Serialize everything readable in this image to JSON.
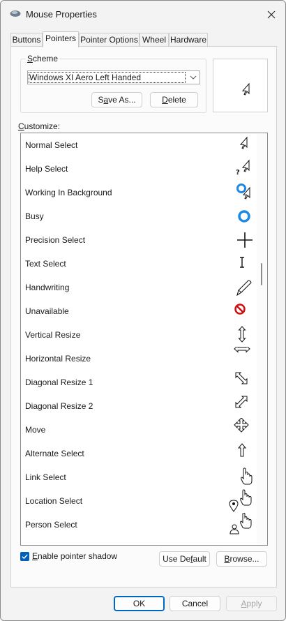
{
  "window": {
    "title": "Mouse Properties",
    "close_label": "×"
  },
  "tabs": [
    {
      "label": "Buttons",
      "active": false
    },
    {
      "label": "Pointers",
      "active": true
    },
    {
      "label": "Pointer Options",
      "active": false
    },
    {
      "label": "Wheel",
      "active": false
    },
    {
      "label": "Hardware",
      "active": false
    }
  ],
  "scheme": {
    "legend": "Scheme",
    "selected": "Windows XI Aero Left Handed",
    "save_as_label": "Save As...",
    "delete_label": "Delete"
  },
  "preview": {
    "icon": "left-handed-arrow-icon"
  },
  "customize": {
    "label": "Customize:",
    "items": [
      {
        "label": "Normal Select",
        "icon": "normal-select-cursor-icon"
      },
      {
        "label": "Help Select",
        "icon": "help-select-cursor-icon"
      },
      {
        "label": "Working In Background",
        "icon": "working-background-cursor-icon"
      },
      {
        "label": "Busy",
        "icon": "busy-cursor-icon"
      },
      {
        "label": "Precision Select",
        "icon": "crosshair-cursor-icon"
      },
      {
        "label": "Text Select",
        "icon": "text-beam-cursor-icon"
      },
      {
        "label": "Handwriting",
        "icon": "pen-cursor-icon"
      },
      {
        "label": "Unavailable",
        "icon": "unavailable-cursor-icon"
      },
      {
        "label": "Vertical Resize",
        "icon": "vertical-resize-cursor-icon"
      },
      {
        "label": "Horizontal Resize",
        "icon": "horizontal-resize-cursor-icon"
      },
      {
        "label": "Diagonal Resize 1",
        "icon": "diagonal-resize-1-cursor-icon"
      },
      {
        "label": "Diagonal Resize 2",
        "icon": "diagonal-resize-2-cursor-icon"
      },
      {
        "label": "Move",
        "icon": "move-cursor-icon"
      },
      {
        "label": "Alternate Select",
        "icon": "up-arrow-cursor-icon"
      },
      {
        "label": "Link Select",
        "icon": "hand-cursor-icon"
      },
      {
        "label": "Location Select",
        "icon": "location-hand-cursor-icon"
      },
      {
        "label": "Person Select",
        "icon": "person-hand-cursor-icon"
      }
    ]
  },
  "options": {
    "enable_shadow_label": "Enable pointer shadow",
    "enable_shadow_checked": true,
    "use_default_label": "Use Default",
    "browse_label": "Browse..."
  },
  "footer": {
    "ok_label": "OK",
    "cancel_label": "Cancel",
    "apply_label": "Apply"
  },
  "colors": {
    "accent": "#005fb8",
    "busy_ring": "#1e88e5",
    "unavailable": "#d01010"
  }
}
